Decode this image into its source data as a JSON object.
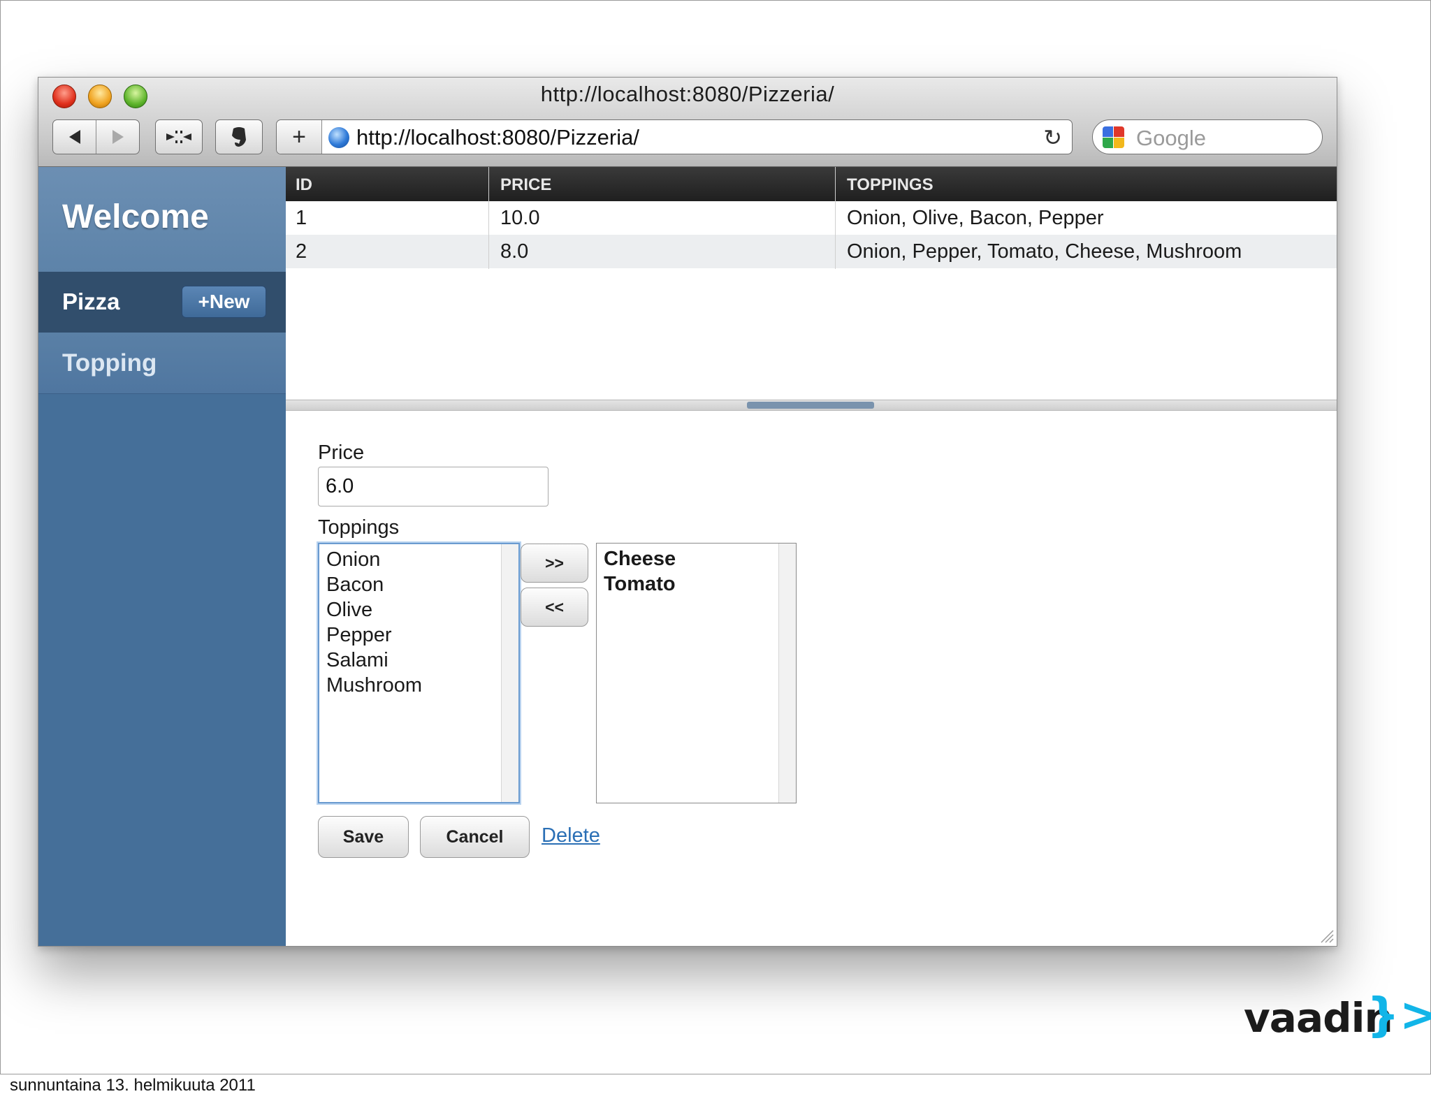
{
  "window": {
    "title": "http://localhost:8080/Pizzeria/",
    "address_url": "http://localhost:8080/Pizzeria/",
    "search_placeholder": "Google",
    "plus_label": "+"
  },
  "sidebar": {
    "welcome": "Welcome",
    "items": [
      {
        "label": "Pizza",
        "action_label": "+New",
        "selected": true
      },
      {
        "label": "Topping",
        "selected": false
      }
    ]
  },
  "table": {
    "columns": [
      "ID",
      "PRICE",
      "TOPPINGS"
    ],
    "rows": [
      [
        "1",
        "10.0",
        "Onion, Olive, Bacon, Pepper"
      ],
      [
        "2",
        "8.0",
        "Onion, Pepper, Tomato, Cheese, Mushroom"
      ]
    ]
  },
  "form": {
    "price_label": "Price",
    "price_value": "6.0",
    "toppings_label": "Toppings",
    "available": [
      "Onion",
      "Bacon",
      "Olive",
      "Pepper",
      "Salami",
      "Mushroom"
    ],
    "selected": [
      "Cheese",
      "Tomato"
    ],
    "add_label": ">>",
    "remove_label": "<<",
    "save_label": "Save",
    "cancel_label": "Cancel",
    "delete_label": "Delete"
  },
  "slide": {
    "footer": "sunnuntaina 13. helmikuuta 2011",
    "logo_text": "vaadin",
    "logo_mark": "}>"
  },
  "colors": {
    "sidebar": "#456f99",
    "sidebar_selected": "#314e6c",
    "table_header": "#2a2a2a",
    "link": "#2a6fb5",
    "logo_accent": "#12b5e8"
  },
  "icons": {
    "back": "back-arrow-icon",
    "forward": "forward-arrow-icon",
    "snap": "snapback-icon",
    "evernote": "evernote-icon",
    "globe": "globe-icon",
    "reload": "reload-icon",
    "search_engine": "google-icon",
    "resize": "resize-grip-icon"
  }
}
